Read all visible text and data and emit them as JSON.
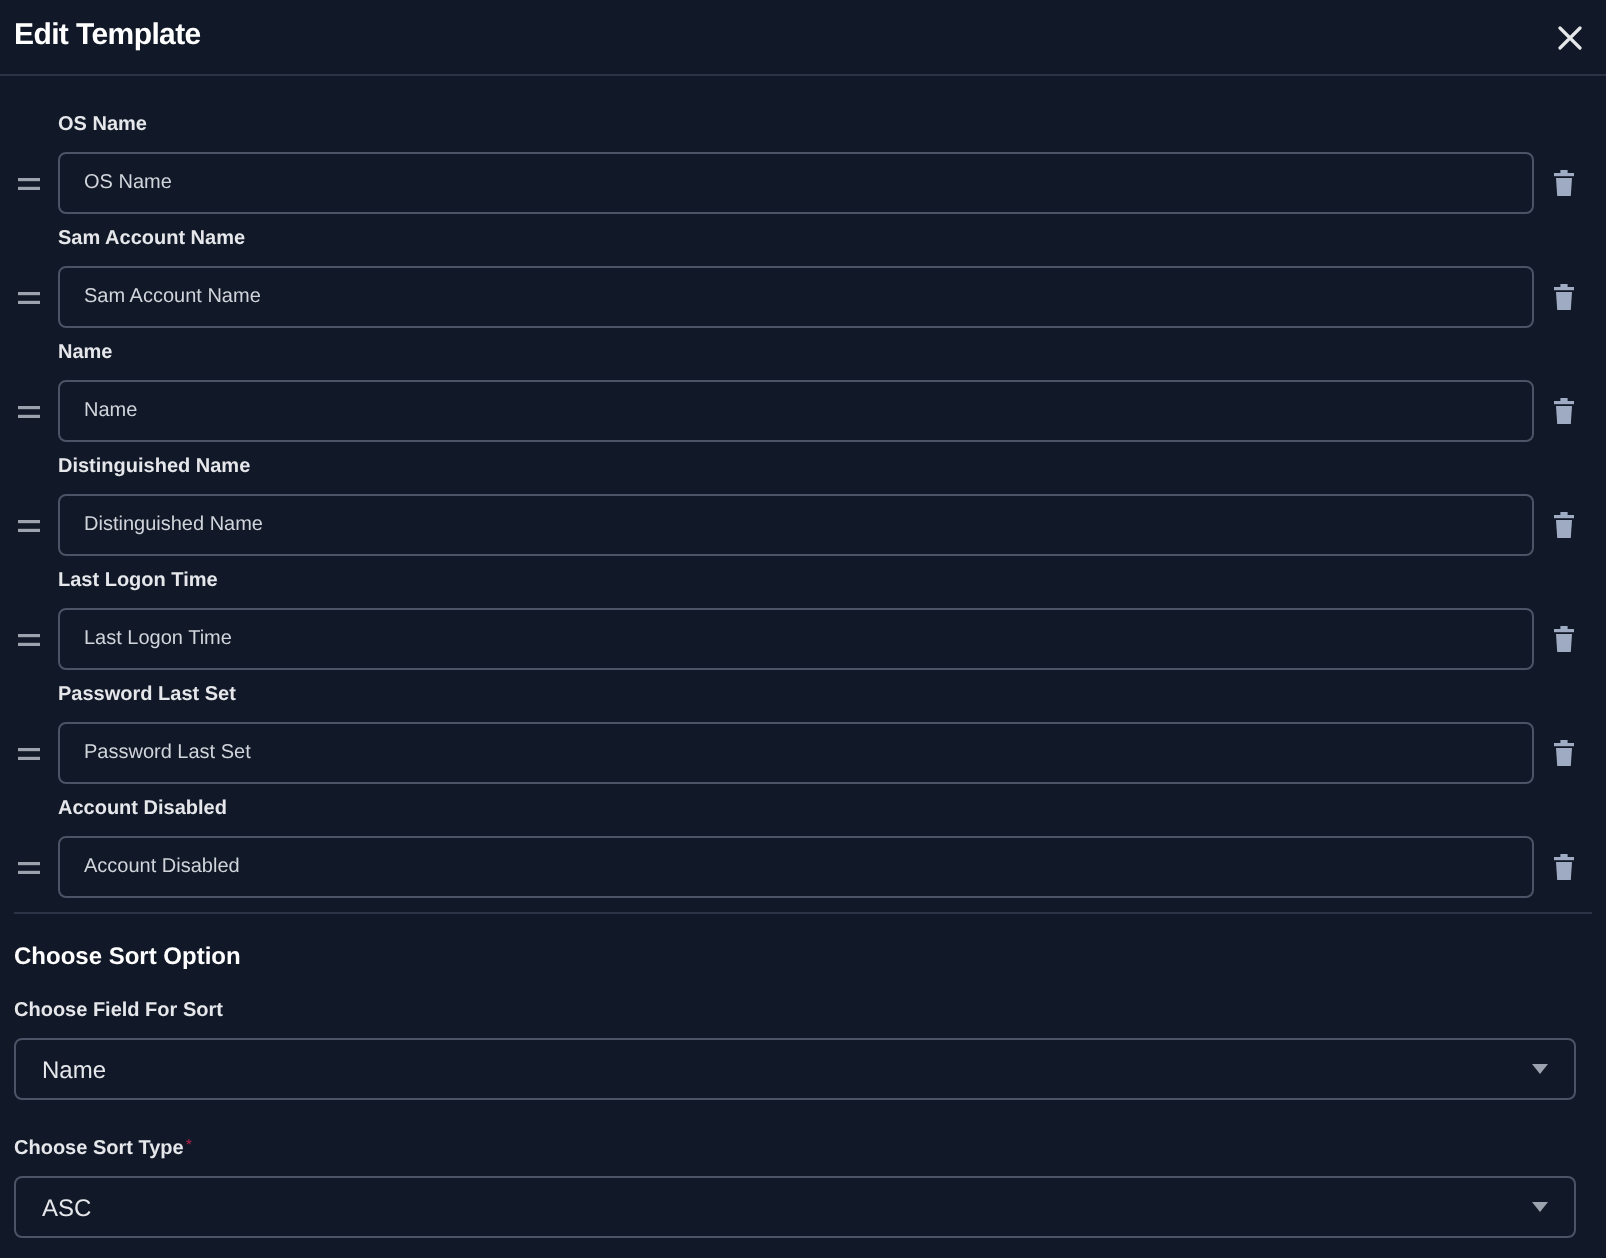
{
  "dialog": {
    "title": "Edit Template"
  },
  "fields": [
    {
      "label": "OS Name",
      "value": "OS Name"
    },
    {
      "label": "Sam Account Name",
      "value": "Sam Account Name"
    },
    {
      "label": "Name",
      "value": "Name"
    },
    {
      "label": "Distinguished Name",
      "value": "Distinguished Name"
    },
    {
      "label": "Last Logon Time",
      "value": "Last Logon Time"
    },
    {
      "label": "Password Last Set",
      "value": "Password Last Set"
    },
    {
      "label": "Account Disabled",
      "value": "Account Disabled"
    }
  ],
  "sort": {
    "heading": "Choose Sort Option",
    "selects": [
      {
        "label": "Choose Field For Sort",
        "value": "Name"
      },
      {
        "label": "Choose Sort Type",
        "required_mark": "*",
        "value": "ASC"
      }
    ]
  }
}
